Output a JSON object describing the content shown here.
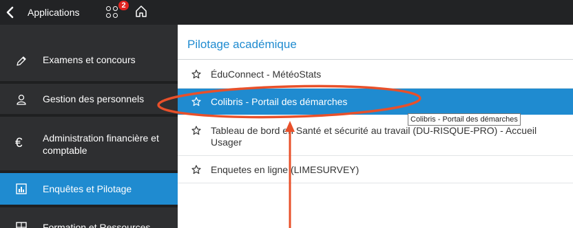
{
  "topbar": {
    "back_label": "Applications",
    "notification_count": "2"
  },
  "sidebar": {
    "items": [
      {
        "label": "Examens et concours",
        "icon": "pencil-icon"
      },
      {
        "label": "Gestion des personnels",
        "icon": "user-icon"
      },
      {
        "label": "Administration financière et comptable",
        "icon": "euro-icon"
      },
      {
        "label": "Enquêtes et Pilotage",
        "icon": "chart-icon",
        "active": true
      },
      {
        "label": "Formation et Ressources",
        "icon": "grid-icon"
      }
    ]
  },
  "main": {
    "title": "Pilotage académique",
    "rows": [
      {
        "label": "ÉduConnect - MétéoStats"
      },
      {
        "label": "Colibris - Portail des démarches",
        "selected": true
      },
      {
        "label": "Tableau de bord en Santé et sécurité au travail (DU-RISQUE-PRO) - Accueil Usager"
      },
      {
        "label": "Enquetes en ligne (LIMESURVEY)"
      }
    ],
    "tooltip": "Colibris - Portail des démarches"
  },
  "colors": {
    "accent": "#1f8bd0",
    "topbar": "#222325",
    "sidebar": "#2e2f31",
    "annotation": "#e8502a",
    "badge": "#e0231f"
  }
}
